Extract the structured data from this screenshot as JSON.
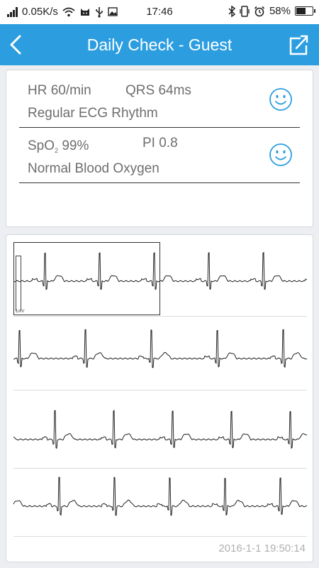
{
  "status_bar": {
    "speed": "0.05K/s",
    "time": "17:46",
    "battery": "58%",
    "battery_level": 0.58
  },
  "header": {
    "title": "Daily Check - Guest"
  },
  "ecg_summary": {
    "hr": "HR 60/min",
    "qrs": "QRS 64ms",
    "rhythm": "Regular ECG Rhythm"
  },
  "oxygen_summary": {
    "spo2_prefix": "SpO",
    "spo2_sub": "2",
    "spo2_value": "99%",
    "pi": "PI 0.8",
    "status": "Normal Blood Oxygen"
  },
  "waveform": {
    "calibration_label": "1mV",
    "timestamp": "2016-1-1 19:50:14"
  },
  "icons": {
    "back": "chevron-left-icon",
    "share": "share-icon",
    "status_ok": "smiley-icon"
  },
  "colors": {
    "primary": "#2c9ee0",
    "text": "#6e6e6e",
    "timestamp": "#b0b0b0"
  }
}
